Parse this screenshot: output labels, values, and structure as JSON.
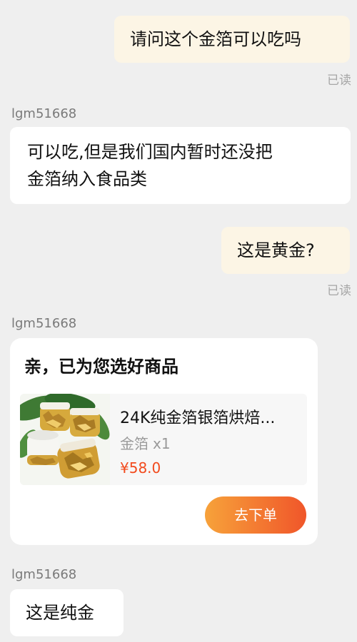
{
  "messages": {
    "m1": {
      "text": "请问这个金箔可以吃吗",
      "status": "已读"
    },
    "m2": {
      "sender": "lgm51668",
      "line1": "可以吃,但是我们国内暂时还没把",
      "line2": "金箔纳入食品类"
    },
    "m3": {
      "text": "这是黄金?",
      "status": "已读"
    },
    "m4": {
      "sender": "lgm51668",
      "card_title": "亲，已为您选好商品",
      "product": {
        "name": "24K纯金箔银箔烘焙...",
        "spec": "金箔",
        "quantity": "x1",
        "price": "¥58.0",
        "image": "gold-leaf-jars-product-photo"
      },
      "button_label": "去下单"
    },
    "m5": {
      "sender": "lgm51668",
      "text": "这是纯金"
    }
  },
  "colors": {
    "background": "#efefef",
    "outgoing_bubble": "#fcf5e5",
    "incoming_bubble": "#ffffff",
    "price": "#f24a1d",
    "button_gradient_start": "#f7a23a",
    "button_gradient_end": "#f0562a"
  }
}
